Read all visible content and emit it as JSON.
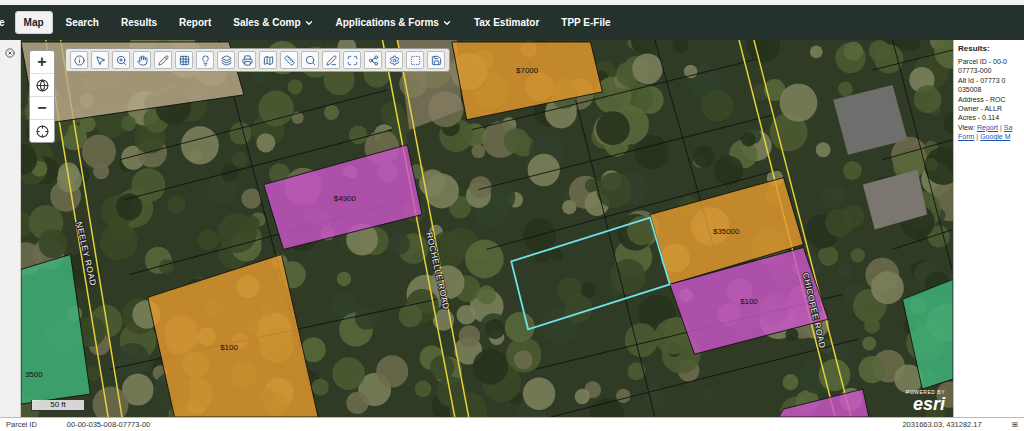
{
  "nav": {
    "cut_item": "e",
    "tabs": [
      {
        "label": "Map",
        "selected": true,
        "kind": "link"
      },
      {
        "label": "Search",
        "selected": false,
        "kind": "link"
      },
      {
        "label": "Results",
        "selected": false,
        "kind": "link"
      },
      {
        "label": "Report",
        "selected": false,
        "kind": "link"
      },
      {
        "label": "Sales & Comp",
        "selected": false,
        "kind": "menu"
      },
      {
        "label": "Applications & Forms",
        "selected": false,
        "kind": "menu"
      },
      {
        "label": "Tax Estimator",
        "selected": false,
        "kind": "link"
      },
      {
        "label": "TPP E-File",
        "selected": false,
        "kind": "link"
      }
    ]
  },
  "zoom": {
    "in": "+",
    "out": "−"
  },
  "map": {
    "parcels": [
      {
        "label": "$7000",
        "color": "#e39a2d",
        "selected": false
      },
      {
        "label": "$4900",
        "color": "#c855c8",
        "selected": false
      },
      {
        "label": "$100",
        "color": "#e39a2d",
        "selected": false
      },
      {
        "label": "$35000",
        "color": "#e39a2d",
        "selected": false
      },
      {
        "label": "$100",
        "color": "#c855c8",
        "selected": false
      },
      {
        "label": "",
        "color": "#6fe3e8",
        "selected": true
      },
      {
        "label": "3500",
        "color": "#3fb47a",
        "selected": false
      },
      {
        "label": "",
        "color": "#3fb47a",
        "selected": false
      },
      {
        "label": "",
        "color": "#c855c8",
        "selected": false
      },
      {
        "label": "",
        "color": "#b8a888",
        "selected": false
      }
    ],
    "roads": [
      {
        "name": "NEELEY ROAD"
      },
      {
        "name": "ROCHELLE ROAD"
      },
      {
        "name": "CHICOPEE ROAD"
      }
    ],
    "scale": "50 ft",
    "attribution": {
      "top": "POWERED BY",
      "logo": "esri"
    }
  },
  "results": {
    "title": "Results:",
    "lines": [
      "Parcel ID - 00-0",
      "07773-000",
      "Alt Id - 07773 0",
      "035008",
      "Address - ROC",
      "Owner - ALLR",
      "Acres - 0.114"
    ],
    "view_label": "View:",
    "links": [
      "Report",
      "Sa",
      "Form",
      "Google M"
    ],
    "separator": "|"
  },
  "status_bar": {
    "label": "Parcel ID",
    "value": "00-00-035-008-07773-00",
    "coordinates": "2031663.03, 431282.17",
    "expand": "⊞"
  }
}
